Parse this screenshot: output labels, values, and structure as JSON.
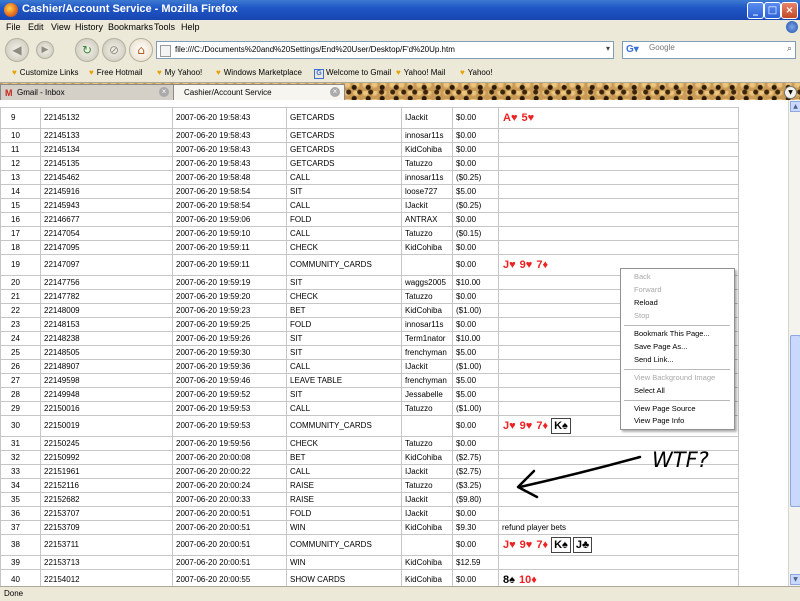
{
  "window": {
    "title": "Cashier/Account Service - Mozilla Firefox"
  },
  "menu": [
    "File",
    "Edit",
    "View",
    "History",
    "Bookmarks",
    "Tools",
    "Help"
  ],
  "nav": {
    "url": "file:///C:/Documents%20and%20Settings/End%20User/Desktop/F'd%20Up.htm",
    "search_placeholder": "Google"
  },
  "bookmarks": [
    "Customize Links",
    "Free Hotmail",
    "My Yahoo!",
    "Windows Marketplace",
    "Welcome to Gmail",
    "Yahoo! Mail",
    "Yahoo!"
  ],
  "tabs": [
    {
      "label": "Gmail - Inbox"
    },
    {
      "label": "Cashier/Account Service"
    }
  ],
  "table": {
    "rows": [
      {
        "n": "9",
        "id": "22145132",
        "time": "2007-06-20 19:58:43",
        "action": "GETCARDS",
        "player": "IJackit",
        "amount": "$0.00",
        "cards": [
          {
            "r": "A",
            "s": "♥",
            "c": "red"
          },
          {
            "r": "5",
            "s": "♥",
            "c": "red"
          }
        ]
      },
      {
        "n": "10",
        "id": "22145133",
        "time": "2007-06-20 19:58:43",
        "action": "GETCARDS",
        "player": "innosar11s",
        "amount": "$0.00"
      },
      {
        "n": "11",
        "id": "22145134",
        "time": "2007-06-20 19:58:43",
        "action": "GETCARDS",
        "player": "KidCohiba",
        "amount": "$0.00"
      },
      {
        "n": "12",
        "id": "22145135",
        "time": "2007-06-20 19:58:43",
        "action": "GETCARDS",
        "player": "Tatuzzo",
        "amount": "$0.00"
      },
      {
        "n": "13",
        "id": "22145462",
        "time": "2007-06-20 19:58:48",
        "action": "CALL",
        "player": "innosar11s",
        "amount": "($0.25)"
      },
      {
        "n": "14",
        "id": "22145916",
        "time": "2007-06-20 19:58:54",
        "action": "SIT",
        "player": "loose727",
        "amount": "$5.00"
      },
      {
        "n": "15",
        "id": "22145943",
        "time": "2007-06-20 19:58:54",
        "action": "CALL",
        "player": "IJackit",
        "amount": "($0.25)"
      },
      {
        "n": "16",
        "id": "22146677",
        "time": "2007-06-20 19:59:06",
        "action": "FOLD",
        "player": "ANTRAX",
        "amount": "$0.00"
      },
      {
        "n": "17",
        "id": "22147054",
        "time": "2007-06-20 19:59:10",
        "action": "CALL",
        "player": "Tatuzzo",
        "amount": "($0.15)"
      },
      {
        "n": "18",
        "id": "22147095",
        "time": "2007-06-20 19:59:11",
        "action": "CHECK",
        "player": "KidCohiba",
        "amount": "$0.00"
      },
      {
        "n": "19",
        "id": "22147097",
        "time": "2007-06-20 19:59:11",
        "action": "COMMUNITY_CARDS",
        "player": "",
        "amount": "$0.00",
        "cards": [
          {
            "r": "J",
            "s": "♥",
            "c": "red"
          },
          {
            "r": "9",
            "s": "♥",
            "c": "red"
          },
          {
            "r": "7",
            "s": "♦",
            "c": "red"
          }
        ]
      },
      {
        "n": "20",
        "id": "22147756",
        "time": "2007-06-20 19:59:19",
        "action": "SIT",
        "player": "waggs2005",
        "amount": "$10.00"
      },
      {
        "n": "21",
        "id": "22147782",
        "time": "2007-06-20 19:59:20",
        "action": "CHECK",
        "player": "Tatuzzo",
        "amount": "$0.00"
      },
      {
        "n": "22",
        "id": "22148009",
        "time": "2007-06-20 19:59:23",
        "action": "BET",
        "player": "KidCohiba",
        "amount": "($1.00)"
      },
      {
        "n": "23",
        "id": "22148153",
        "time": "2007-06-20 19:59:25",
        "action": "FOLD",
        "player": "innosar11s",
        "amount": "$0.00"
      },
      {
        "n": "24",
        "id": "22148238",
        "time": "2007-06-20 19:59:26",
        "action": "SIT",
        "player": "Term1nator",
        "amount": "$10.00"
      },
      {
        "n": "25",
        "id": "22148505",
        "time": "2007-06-20 19:59:30",
        "action": "SIT",
        "player": "frenchyman",
        "amount": "$5.00"
      },
      {
        "n": "26",
        "id": "22148907",
        "time": "2007-06-20 19:59:36",
        "action": "CALL",
        "player": "IJackit",
        "amount": "($1.00)"
      },
      {
        "n": "27",
        "id": "22149598",
        "time": "2007-06-20 19:59:46",
        "action": "LEAVE TABLE",
        "player": "frenchyman",
        "amount": "$5.00"
      },
      {
        "n": "28",
        "id": "22149948",
        "time": "2007-06-20 19:59:52",
        "action": "SIT",
        "player": "Jessabelle",
        "amount": "$5.00"
      },
      {
        "n": "29",
        "id": "22150016",
        "time": "2007-06-20 19:59:53",
        "action": "CALL",
        "player": "Tatuzzo",
        "amount": "($1.00)"
      },
      {
        "n": "30",
        "id": "22150019",
        "time": "2007-06-20 19:59:53",
        "action": "COMMUNITY_CARDS",
        "player": "",
        "amount": "$0.00",
        "cards": [
          {
            "r": "J",
            "s": "♥",
            "c": "red"
          },
          {
            "r": "9",
            "s": "♥",
            "c": "red"
          },
          {
            "r": "7",
            "s": "♦",
            "c": "red"
          },
          {
            "r": "K",
            "s": "♠",
            "c": "black",
            "boxed": true
          }
        ]
      },
      {
        "n": "31",
        "id": "22150245",
        "time": "2007-06-20 19:59:56",
        "action": "CHECK",
        "player": "Tatuzzo",
        "amount": "$0.00"
      },
      {
        "n": "32",
        "id": "22150992",
        "time": "2007-06-20 20:00:08",
        "action": "BET",
        "player": "KidCohiba",
        "amount": "($2.75)"
      },
      {
        "n": "33",
        "id": "22151961",
        "time": "2007-06-20 20:00:22",
        "action": "CALL",
        "player": "IJackit",
        "amount": "($2.75)"
      },
      {
        "n": "34",
        "id": "22152116",
        "time": "2007-06-20 20:00:24",
        "action": "RAISE",
        "player": "Tatuzzo",
        "amount": "($3.25)"
      },
      {
        "n": "35",
        "id": "22152682",
        "time": "2007-06-20 20:00:33",
        "action": "RAISE",
        "player": "IJackit",
        "amount": "($9.80)"
      },
      {
        "n": "36",
        "id": "22153707",
        "time": "2007-06-20 20:00:51",
        "action": "FOLD",
        "player": "IJackit",
        "amount": "$0.00"
      },
      {
        "n": "37",
        "id": "22153709",
        "time": "2007-06-20 20:00:51",
        "action": "WIN",
        "player": "KidCohiba",
        "amount": "$9.30",
        "note": "refund player bets"
      },
      {
        "n": "38",
        "id": "22153711",
        "time": "2007-06-20 20:00:51",
        "action": "COMMUNITY_CARDS",
        "player": "",
        "amount": "$0.00",
        "cards": [
          {
            "r": "J",
            "s": "♥",
            "c": "red"
          },
          {
            "r": "9",
            "s": "♥",
            "c": "red"
          },
          {
            "r": "7",
            "s": "♦",
            "c": "red"
          },
          {
            "r": "K",
            "s": "♠",
            "c": "black",
            "boxed": true
          },
          {
            "r": "J",
            "s": "♣",
            "c": "black",
            "boxed": true
          }
        ]
      },
      {
        "n": "39",
        "id": "22153713",
        "time": "2007-06-20 20:00:51",
        "action": "WIN",
        "player": "KidCohiba",
        "amount": "$12.59"
      },
      {
        "n": "40",
        "id": "22154012",
        "time": "2007-06-20 20:00:55",
        "action": "SHOW CARDS",
        "player": "KidCohiba",
        "amount": "$0.00",
        "cards": [
          {
            "r": "8",
            "s": "♠",
            "c": "black"
          },
          {
            "r": "10",
            "s": "♦",
            "c": "red"
          }
        ]
      }
    ]
  },
  "context_menu": [
    {
      "label": "Back",
      "enabled": false
    },
    {
      "label": "Forward",
      "enabled": false
    },
    {
      "label": "Reload",
      "enabled": true
    },
    {
      "label": "Stop",
      "enabled": false
    },
    {
      "label": "Bookmark This Page...",
      "enabled": true
    },
    {
      "label": "Save Page As...",
      "enabled": true
    },
    {
      "label": "Send Link...",
      "enabled": true
    },
    {
      "label": "View Background Image",
      "enabled": false
    },
    {
      "label": "Select All",
      "enabled": true
    },
    {
      "label": "View Page Source",
      "enabled": true
    },
    {
      "label": "View Page Info",
      "enabled": true
    }
  ],
  "annotation": {
    "text": "WTF?"
  },
  "status": {
    "text": "Done"
  }
}
